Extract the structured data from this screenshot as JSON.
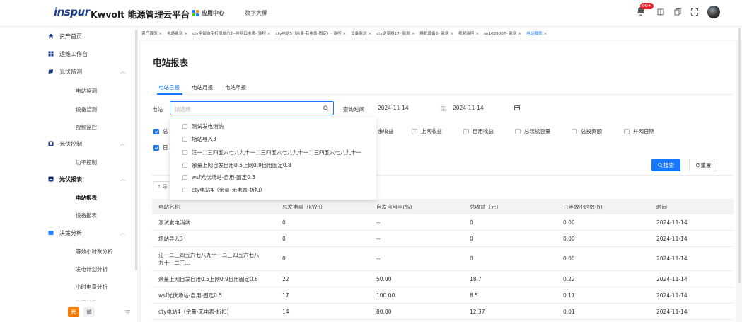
{
  "header": {
    "logo": "inspur",
    "title": "Kwvolt 能源管理云平台",
    "app_center": "应用中心",
    "data_screen": "数字大屏",
    "notif_badge": "99+",
    "colors": {
      "logo": "#1a3a8a",
      "accent": "#1677ff",
      "badge": "#f5222d"
    }
  },
  "sidebar": {
    "asset_home": "资产首页",
    "ops_workbench": "运维工作台",
    "pv_monitor": "光伏监测",
    "station_monitor": "电站监测",
    "device_monitor": "设备监测",
    "video_monitor": "视频监控",
    "pv_control": "光伏控制",
    "power_control": "功率控制",
    "pv_report": "光伏报表",
    "station_report": "电站报表",
    "device_report": "设备报表",
    "decision_analysis": "决策分析",
    "equiv_hours": "等效小时数分析",
    "gen_plan": "发电计划分析",
    "hour_power": "小时电量分析",
    "partial_cut": "功率分析",
    "tag_light": "光",
    "tag_storage": "储",
    "fold_icon": "menu-fold-icon"
  },
  "tabs": [
    {
      "label": "资产首页",
      "active": false
    },
    {
      "label": "电站监测",
      "active": false
    },
    {
      "label": "cty全部自用折扣单价2--并网口电表- 监控",
      "active": false
    },
    {
      "label": "cty电站5（余量-有电表-固定）- 监控",
      "active": false
    },
    {
      "label": "设备监测",
      "active": false
    },
    {
      "label": "cty逆变器17- 监测",
      "active": false
    },
    {
      "label": "换机设备2- 监测",
      "active": false
    },
    {
      "label": "视频监控",
      "active": false
    },
    {
      "label": "sn1029007- 监测",
      "active": false
    },
    {
      "label": "电站报表",
      "active": true
    }
  ],
  "tab_close": "×",
  "page": {
    "title": "电站报表",
    "sub_tabs": [
      "电站日报",
      "电站月报",
      "电站年报"
    ],
    "station_label": "电站",
    "station_placeholder": "请选择",
    "query_time_label": "查询时间",
    "date_start": "2024-11-14",
    "date_sep": "至",
    "date_end": "2024-11-14",
    "search_btn": "搜索",
    "reset_btn": "重置",
    "export_btn": "导"
  },
  "checks_row1": [
    {
      "label": "总",
      "checked": true
    },
    {
      "label": "余收益",
      "checked": false
    },
    {
      "label": "上网收益",
      "checked": false
    },
    {
      "label": "自用收益",
      "checked": false
    },
    {
      "label": "总装机容量",
      "checked": false
    },
    {
      "label": "总投资额",
      "checked": false
    },
    {
      "label": "并网日期",
      "checked": false
    }
  ],
  "checks_row2": [
    {
      "label": "日",
      "checked": true
    }
  ],
  "dropdown": {
    "options": [
      "测试发电消纳",
      "场站导入3",
      "汪一二三四五六七八九十一二三四五六七八九十一二三四五六七八九十一",
      "余量上网自发自用0.5上网0.9自用固定0.8",
      "wsf光伏场站-自用-固定0.5",
      "cty电站4（余量-无电表-折扣）"
    ]
  },
  "table": {
    "headers": [
      "电站名称",
      "总发电量（kWh）",
      "自发自用率(%)",
      "总收益（元）",
      "日等效小时数(h)",
      "时间"
    ],
    "rows": [
      [
        "测试发电消纳",
        "0",
        "--",
        "0",
        "0.00",
        "2024-11-14"
      ],
      [
        "场站导入3",
        "0",
        "--",
        "0",
        "0.00",
        "2024-11-14"
      ],
      [
        "汪一二三四五六七八九十一二三四五六七八九十一二三...",
        "0",
        "--",
        "0",
        "0.00",
        "2024-11-14"
      ],
      [
        "余量上网自发自用0.5上网0.9自用固定0.8",
        "22",
        "50.00",
        "18.7",
        "0.22",
        "2024-11-14"
      ],
      [
        "wsf光伏场站-自用-固定0.5",
        "17",
        "100.00",
        "8.5",
        "0.17",
        "2024-11-14"
      ],
      [
        "cty电站4（余量-无电表-折扣）",
        "14",
        "80.00",
        "12.37",
        "0.01",
        "2024-11-14"
      ]
    ]
  }
}
